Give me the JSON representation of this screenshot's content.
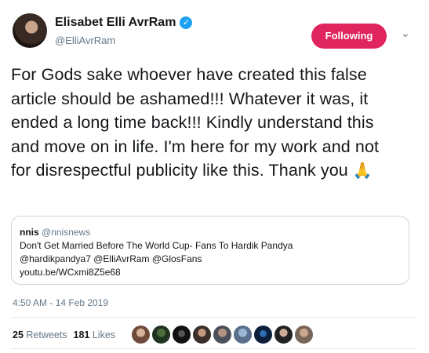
{
  "author": {
    "name": "Elisabet Elli AvrRam",
    "handle": "@ElliAvrRam",
    "verified_icon": "verified-badge-icon"
  },
  "follow_label": "Following",
  "tweet": {
    "text": "For Gods sake whoever have created this false article should be ashamed!!! Whatever it was, it ended a long time back!!! Kindly understand this and move on in life. I'm here for my work and not for disrespectful publicity like this. Thank you",
    "emoji": "🙏"
  },
  "quote": {
    "name": "nnis",
    "handle": "@nnisnews",
    "line1": "Don't Get Married Before The World Cup- Fans To Hardik Pandya",
    "line2": "@hardikpandya7 @ElliAvrRam @GlosFans",
    "line3": "youtu.be/WCxmi8Z5e68"
  },
  "timestamp": "4:50 AM - 14 Feb 2019",
  "stats": {
    "retweets_count": "25",
    "retweets_label": "Retweets",
    "likes_count": "181",
    "likes_label": "Likes"
  },
  "colors": {
    "follow_button": "#e0245e",
    "verified": "#1da1f2",
    "muted_text": "#657786"
  }
}
